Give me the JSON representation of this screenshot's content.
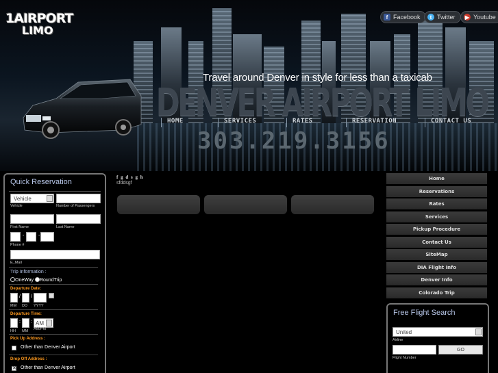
{
  "logo": {
    "line1": "1AIRPORT",
    "line2": "LIMO"
  },
  "social": [
    {
      "label": "Facebook",
      "icon": "facebook-icon",
      "color": "#3b5998"
    },
    {
      "label": "Twitter",
      "icon": "twitter-icon",
      "color": "#4ab3f4"
    },
    {
      "label": "Youtube",
      "icon": "youtube-icon",
      "color": "#cc3a2b"
    }
  ],
  "header": {
    "tagline": "Travel around Denver in style for less than a taxicab",
    "title": "DENVER AIRPORT LIMO",
    "phone": "303.219.3156",
    "nav": [
      "HOME",
      "SERVICES",
      "RATES",
      "RESERVATION",
      "CONTACT US"
    ]
  },
  "quick_reservation": {
    "title": "Quick Reservation",
    "vehicle_value": "Vehicle",
    "vehicle_caption": "Vehicle",
    "passengers_caption": "Number of Passengers",
    "first_name_caption": "First Name",
    "last_name_caption": "Last Name",
    "phone_caption": "Phone #",
    "phone_sep": "-",
    "email_caption": "E_Mail",
    "trip_label": "Trip Information :",
    "oneway_label": "OneWay",
    "roundtrip_label": "RoundTrip",
    "departure_date_label": "Departure Date:",
    "mm_caption": "MM",
    "dd_caption": "DD",
    "yyyy_caption": "YYYY",
    "date_sep": "/",
    "departure_time_label": "Departure Time:",
    "hh_caption": "HH",
    "min_caption": "MM",
    "ampm_caption": "AM/PM",
    "ampm_value": "AM",
    "time_sep": ":",
    "pickup_label": "Pick Up Address :",
    "pickup_option": "Other than Denver Airport",
    "dropoff_label": "Drop Off Address :",
    "dropoff_option": "Other than Denver Airport",
    "dropoff_checked_mark": "✕"
  },
  "center": {
    "title": "f g d s g h",
    "subtitle": "sfddsgf"
  },
  "right_menu": [
    "Home",
    "Reservations",
    "Rates",
    "Services",
    "Pickup Procedure",
    "Contact Us",
    "SiteMap",
    "DIA Flight Info",
    "Denver Info",
    "Colorado Trip"
  ],
  "flight_search": {
    "title": "Free Flight Search",
    "airline_value": "United",
    "airline_caption": "Airline",
    "flight_number_caption": "Flight Number",
    "go_label": "GO"
  }
}
